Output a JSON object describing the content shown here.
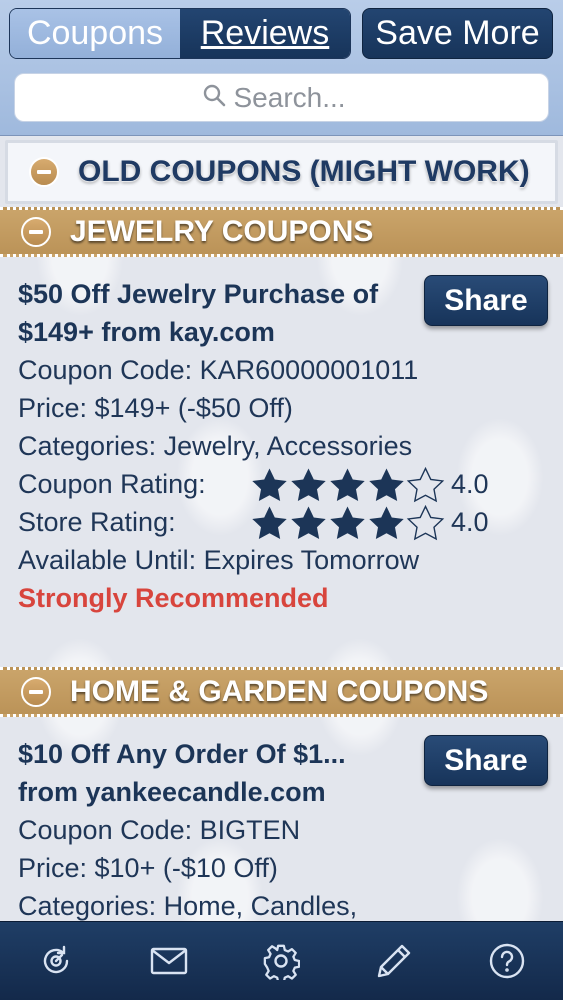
{
  "header": {
    "tabs": [
      {
        "label": "Coupons",
        "active": false
      },
      {
        "label": "Reviews",
        "active": true
      }
    ],
    "save_more_label": "Save More",
    "search_placeholder": "Search..."
  },
  "sections": {
    "old": {
      "title": "OLD COUPONS (MIGHT WORK)"
    },
    "jewelry": {
      "title": "JEWELRY COUPONS",
      "coupon": {
        "title": "$50 Off Jewelry Purchase of $149+ from kay.com",
        "code": "Coupon Code: KAR60000001011",
        "price": "Price: $149+ (-$50 Off)",
        "categories": "Categories: Jewelry, Accessories",
        "coupon_rating_label": "Coupon Rating:",
        "coupon_rating": 4.0,
        "coupon_rating_text": "4.0",
        "store_rating_label": "Store Rating:",
        "store_rating": 4.0,
        "store_rating_text": "4.0",
        "available": "Available Until: Expires Tomorrow",
        "recommendation": "Strongly Recommended",
        "share_label": "Share"
      }
    },
    "home": {
      "title": "HOME & GARDEN COUPONS",
      "coupon": {
        "title": "$10 Off Any Order Of $1... from yankeecandle.com",
        "code": "Coupon Code: BIGTEN",
        "price": "Price: $10+ (-$10 Off)",
        "categories": "Categories: Home, Candles,",
        "share_label": "Share"
      }
    }
  },
  "tabbar": {
    "icons": [
      "refresh-icon",
      "mail-icon",
      "gear-icon",
      "pencil-icon",
      "help-icon"
    ]
  },
  "colors": {
    "header_bg": "#a9c2e6",
    "navy": "#1c3557",
    "section_gold": "#c39c62",
    "recommend_red": "#d8453d",
    "tabbar_bg": "#1a3559"
  }
}
